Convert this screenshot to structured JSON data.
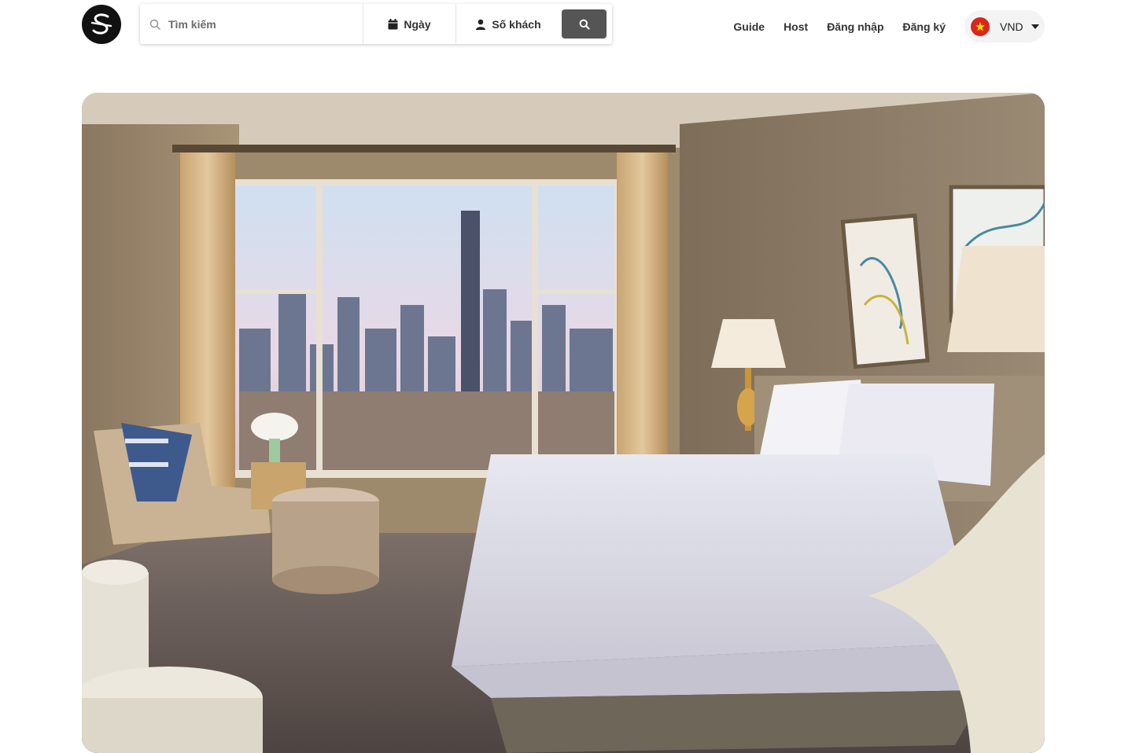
{
  "brand": {
    "logo_icon": "s-logo-icon"
  },
  "search": {
    "placeholder": "Tìm kiếm",
    "date_label": "Ngày",
    "guests_label": "Số khách"
  },
  "nav": {
    "guide": "Guide",
    "host": "Host",
    "login": "Đăng nhập",
    "signup": "Đăng ký"
  },
  "currency": {
    "code": "VND",
    "flag": "vietnam-flag-icon"
  },
  "hero": {
    "image": "hotel-bedroom-city-view"
  },
  "colors": {
    "search_button": "#555555",
    "flag_red": "#da251d",
    "flag_star": "#ffdd00"
  }
}
